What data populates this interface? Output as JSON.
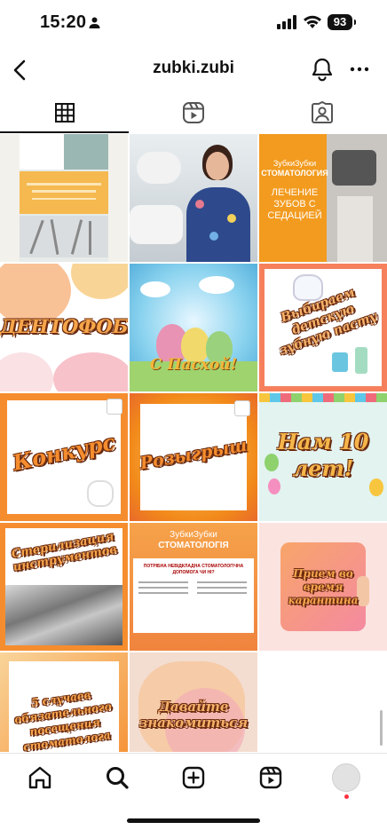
{
  "status_bar": {
    "time": "15:20",
    "battery": "93"
  },
  "header": {
    "username": "zubki.zubi"
  },
  "tabs": [
    {
      "name": "grid",
      "icon": "grid-icon",
      "active": true
    },
    {
      "name": "reels",
      "icon": "reels-icon",
      "active": false
    },
    {
      "name": "tagged",
      "icon": "tagged-icon",
      "active": false
    }
  ],
  "posts": [
    {
      "title": ""
    },
    {
      "title": ""
    },
    {
      "brand": "ЗубкиЗубки",
      "subtitle": "СТОМАТОЛОГИЯ",
      "title": "ЛЕЧЕНИЕ ЗУБОВ С СЕДАЦИЕЙ"
    },
    {
      "title": "ДЕНТОФОБИЯ"
    },
    {
      "title": "С Пасхой!"
    },
    {
      "title": "Выбираем детскую зубную пасту"
    },
    {
      "title": "Конкурс"
    },
    {
      "title": "Розыгрыш"
    },
    {
      "title": "Нам 10 лет!"
    },
    {
      "title": "Стерилизация инструментов"
    },
    {
      "brand": "ЗубкиЗубки",
      "subtitle": "СТОМАТОЛОГІЯ",
      "title": "ПОТРІБНА НЕВІДКЛАДНА СТОМАТОЛОГІЧНА ДОПОМОГА ЧИ НІ?"
    },
    {
      "title": "Прием во время карантина"
    },
    {
      "title": "5 случаев обязательного посещения стоматолога"
    },
    {
      "title": "Давайте знакомиться"
    }
  ],
  "bottom_nav": [
    {
      "name": "home",
      "icon": "home-icon"
    },
    {
      "name": "search",
      "icon": "search-icon"
    },
    {
      "name": "create",
      "icon": "plus-square-icon"
    },
    {
      "name": "reels",
      "icon": "reels-icon"
    },
    {
      "name": "profile",
      "icon": "avatar-icon"
    }
  ],
  "colors": {
    "accent_orange": "#f28a1a",
    "profile_dot": "#ff3040"
  }
}
